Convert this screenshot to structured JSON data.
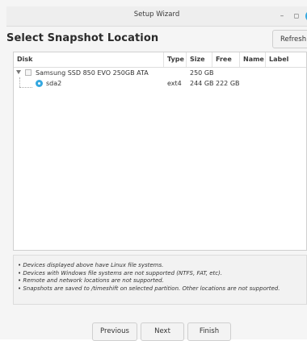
{
  "window": {
    "title": "Setup Wizard",
    "minimize_glyph": "–",
    "maximize_glyph": "◻"
  },
  "page": {
    "heading": "Select Snapshot Location",
    "refresh_label": "Refresh"
  },
  "table": {
    "columns": [
      "Disk",
      "Type",
      "Size",
      "Free",
      "Name",
      "Label"
    ],
    "rows": [
      {
        "disk": "Samsung SSD 850 EVO 250GB ATA",
        "type": "",
        "size": "250 GB",
        "free": "",
        "name": "",
        "label": ""
      },
      {
        "disk": "sda2",
        "type": "ext4",
        "size": "244 GB",
        "free": "222 GB",
        "name": "",
        "label": "",
        "selected": true
      }
    ]
  },
  "notes": [
    "• Devices displayed above have Linux file systems.",
    "• Devices with Windows file systems are not supported (NTFS, FAT, etc).",
    "• Remote and network locations are not supported.",
    "• Snapshots are saved to /timeshift on selected partition. Other locations are not supported."
  ],
  "footer": {
    "previous_label": "Previous",
    "next_label": "Next",
    "finish_label": "Finish"
  },
  "colors": {
    "accent": "#35a8e0"
  }
}
